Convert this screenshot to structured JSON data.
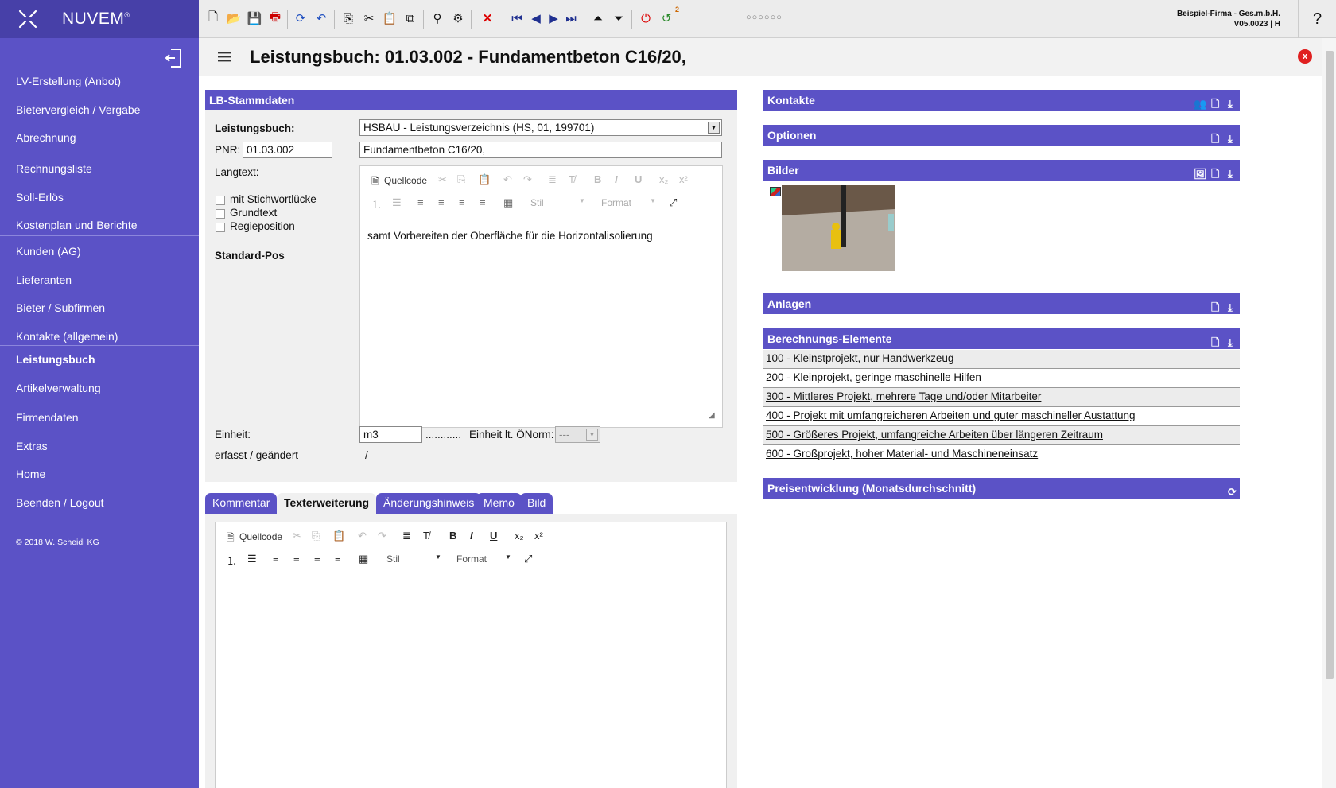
{
  "app": {
    "name": "NUVEM",
    "reg": "®"
  },
  "sidebar": {
    "items": [
      {
        "label": "LV-Erstellung (Anbot)"
      },
      {
        "label": "Bietervergleich / Vergabe"
      },
      {
        "label": "Abrechnung"
      },
      {
        "label": "Rechnungsliste"
      },
      {
        "label": "Soll-Erlös"
      },
      {
        "label": "Kostenplan und Berichte"
      },
      {
        "label": "Kunden (AG)"
      },
      {
        "label": "Lieferanten"
      },
      {
        "label": "Bieter / Subfirmen"
      },
      {
        "label": "Kontakte (allgemein)"
      },
      {
        "label": "Leistungsbuch"
      },
      {
        "label": "Artikelverwaltung"
      },
      {
        "label": "Firmendaten"
      },
      {
        "label": "Extras"
      },
      {
        "label": "Home"
      },
      {
        "label": "Beenden / Logout"
      }
    ],
    "copyright": "© 2018 W. Scheidl KG"
  },
  "toolbar": {
    "dots": "○○○○○○",
    "badge": "2"
  },
  "company": {
    "name": "Beispiel-Firma - Ges.m.b.H.",
    "version": "V05.0023 | H"
  },
  "help": "?",
  "page": {
    "title": "Leistungsbuch: 01.03.002 - Fundamentbeton C16/20,",
    "close": "x"
  },
  "lb": {
    "header": "LB-Stammdaten",
    "leistungsbuch_label": "Leistungsbuch:",
    "leistungsbuch_value": "HSBAU - Leistungsverzeichnis (HS, 01, 199701)",
    "pnr_label": "PNR:",
    "pnr_value": "01.03.002",
    "short_text": "Fundamentbeton C16/20,",
    "langtext_label": "Langtext:",
    "cb1": "mit Stichwortlücke",
    "cb2": "Grundtext",
    "cb3": "Regieposition",
    "standard": "Standard-Pos",
    "editor_text": "samt Vorbereiten der Oberfläche für die Horizontalisolierung",
    "einheit_label": "Einheit:",
    "einheit_value": "m3",
    "dots": "............",
    "oenorm_label": "Einheit lt. ÖNorm:",
    "oenorm_value": "---",
    "erfasst_label": "erfasst / geändert",
    "erfasst_value": "/"
  },
  "editor": {
    "quellcode": "Quellcode",
    "stil": "Stil",
    "format": "Format"
  },
  "tabs": [
    "Kommentar",
    "Texterweiterung",
    "Änderungshinweis",
    "Memo",
    "Bild"
  ],
  "right": {
    "kontakte": "Kontakte",
    "optionen": "Optionen",
    "bilder": "Bilder",
    "anlagen": "Anlagen",
    "berechnung": "Berechnungs-Elemente",
    "preis": "Preisentwicklung (Monatsdurchschnitt)"
  },
  "berechnung_items": [
    "100 - Kleinstprojekt, nur Handwerkzeug",
    "200 - Kleinprojekt, geringe maschinelle Hilfen",
    "300 - Mittleres Projekt, mehrere Tage und/oder Mitarbeiter",
    "400 - Projekt mit umfangreicheren Arbeiten und guter maschineller Austattung",
    "500 - Größeres Projekt, umfangreiche Arbeiten über längeren Zeitraum",
    "600 - Großprojekt, hoher Material- und Maschineneinsatz"
  ]
}
